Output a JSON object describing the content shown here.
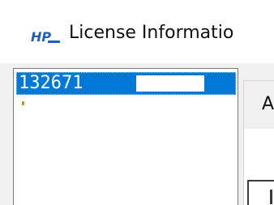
{
  "window": {
    "title": "License Informatio",
    "icon": "hp-logo-icon"
  },
  "license_list": {
    "selected_item": "132671",
    "selected_item_redacted": true
  },
  "tab": {
    "label": "A"
  },
  "colors": {
    "selection": "#0078d7",
    "panel_background": "#f0f0f0",
    "border": "#7a7a7a"
  }
}
